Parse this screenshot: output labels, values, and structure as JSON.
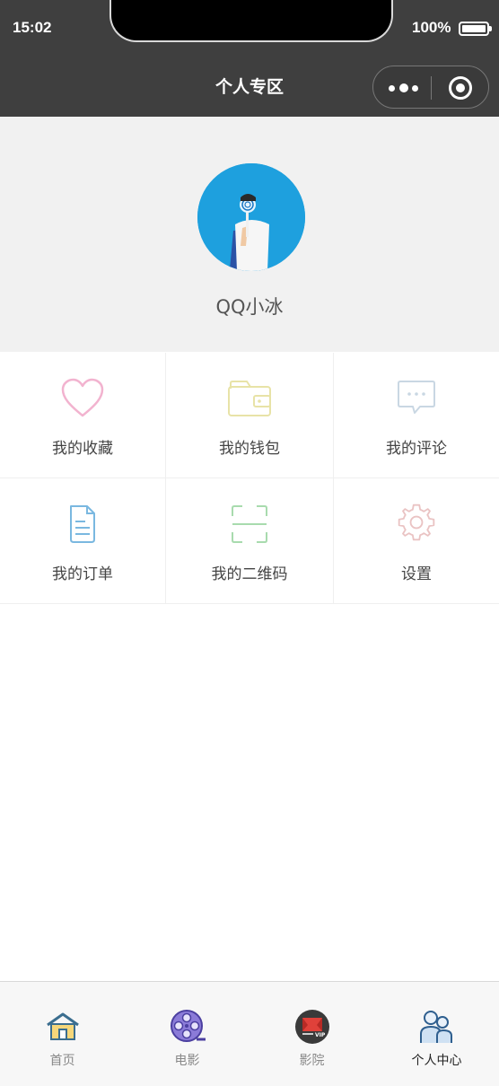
{
  "status_bar": {
    "time": "15:02",
    "battery": "100%"
  },
  "nav": {
    "title": "个人专区"
  },
  "profile": {
    "username": "QQ小冰"
  },
  "menu": [
    {
      "label": "我的收藏",
      "icon": "heart-icon",
      "color": "#f2b3cf"
    },
    {
      "label": "我的钱包",
      "icon": "wallet-icon",
      "color": "#e8e3a7"
    },
    {
      "label": "我的评论",
      "icon": "comment-icon",
      "color": "#c9d7e3"
    },
    {
      "label": "我的订单",
      "icon": "document-icon",
      "color": "#7ab8e0"
    },
    {
      "label": "我的二维码",
      "icon": "qrcode-scan-icon",
      "color": "#a8dbae"
    },
    {
      "label": "设置",
      "icon": "gear-icon",
      "color": "#eac3c3"
    }
  ],
  "tabbar": {
    "items": [
      {
        "label": "首页",
        "icon": "home-icon"
      },
      {
        "label": "电影",
        "icon": "film-reel-icon"
      },
      {
        "label": "影院",
        "icon": "cinema-vip-icon"
      },
      {
        "label": "个人中心",
        "icon": "user-group-icon"
      }
    ],
    "active_index": 3
  }
}
